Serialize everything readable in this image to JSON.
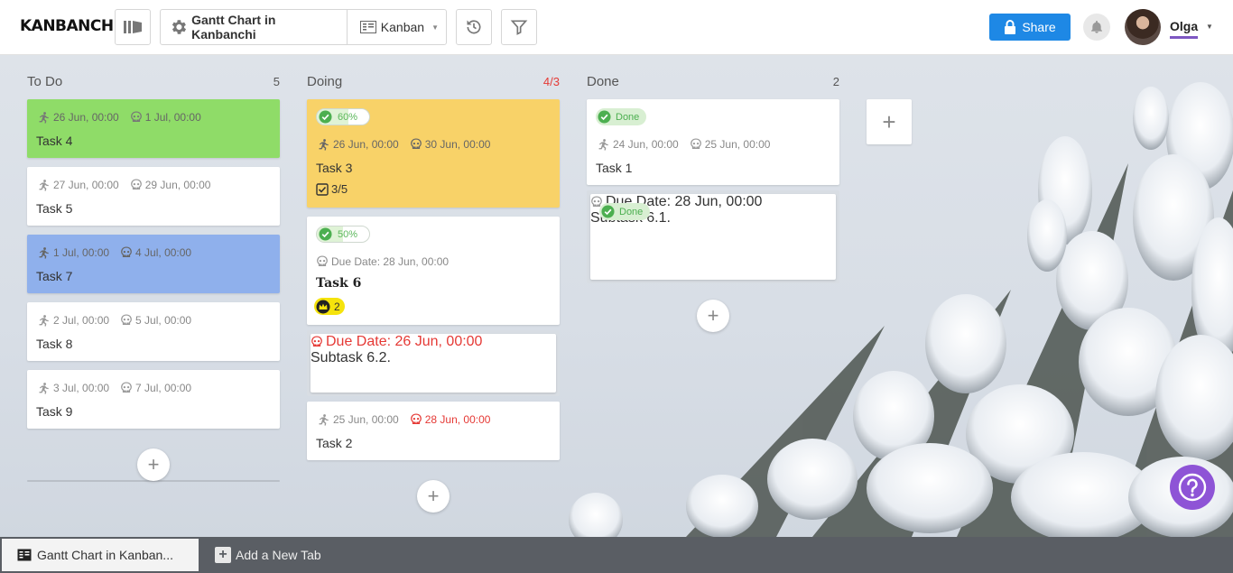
{
  "header": {
    "logo": "KANBANCHI",
    "board_name": "Gantt Chart in Kanbanchi",
    "view": "Kanban",
    "share_label": "Share",
    "user_name": "Olga"
  },
  "columns": [
    {
      "title": "To Do",
      "count": "5",
      "cards": [
        {
          "start": "26 Jun, 00:00",
          "due": "1 Jul, 00:00",
          "title": "Task 4",
          "color": "#8fdc68"
        },
        {
          "start": "27 Jun, 00:00",
          "due": "29 Jun, 00:00",
          "title": "Task 5",
          "color": "#ffffff"
        },
        {
          "start": "1 Jul, 00:00",
          "due": "4 Jul, 00:00",
          "title": "Task 7",
          "color": "#8fb0ec"
        },
        {
          "start": "2 Jul, 00:00",
          "due": "5 Jul, 00:00",
          "title": "Task 8",
          "color": "#ffffff"
        },
        {
          "start": "3 Jul, 00:00",
          "due": "7 Jul, 00:00",
          "title": "Task 9",
          "color": "#ffffff"
        }
      ]
    },
    {
      "title": "Doing",
      "count": "4/3",
      "cards": [
        {
          "progress": "60%",
          "start": "26 Jun, 00:00",
          "due": "30 Jun, 00:00",
          "title": "Task 3",
          "checklist": "3/5",
          "color": "#f8d268"
        },
        {
          "progress": "50%",
          "due_date": "Due Date: 28 Jun, 00:00",
          "title": "Task 6",
          "subcards": "2",
          "color": "#ffffff"
        },
        {
          "due_date": "Due Date: 26 Jun, 00:00",
          "title": "Subtask 6.2."
        },
        {
          "start": "25 Jun, 00:00",
          "due": "28 Jun, 00:00",
          "title": "Task 2",
          "color": "#ffffff"
        }
      ]
    },
    {
      "title": "Done",
      "count": "2",
      "cards": [
        {
          "status": "Done",
          "start": "24 Jun, 00:00",
          "due": "25 Jun, 00:00",
          "title": "Task 1"
        },
        {
          "status": "Done",
          "due_date": "Due Date: 28 Jun, 00:00",
          "title": "Subtask 6.1."
        }
      ]
    }
  ],
  "add_card_label": "+",
  "add_column_label": "+",
  "help_icon": "question-icon",
  "tabs": {
    "active": "Gantt Chart in Kanban...",
    "add_new": "Add a New Tab"
  },
  "colors": {
    "accent": "#1e88e5",
    "overdue": "#e53935",
    "done": "#4caf50",
    "help": "#8e54d6",
    "user_underline": "#7e57c2"
  }
}
